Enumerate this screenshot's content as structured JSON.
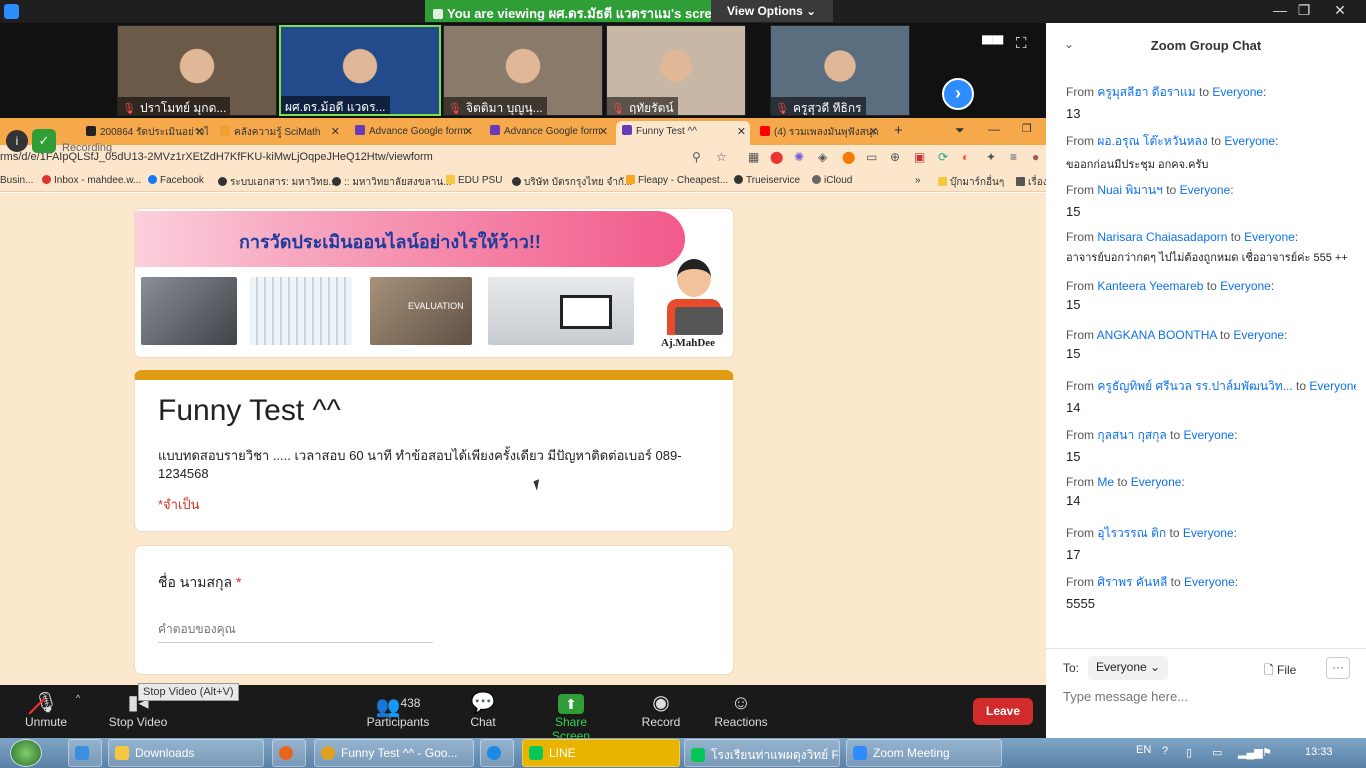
{
  "banner": {
    "viewing_text": "You are viewing ผศ.ดร.มัธตี แวดราแม's screen",
    "view_options": "View Options"
  },
  "participants": [
    {
      "name": "ปราโมทย์ มุกด...",
      "muted": true,
      "active": false,
      "color": "#6b5a48"
    },
    {
      "name": "ผศ.ดร.ม้อดี แวดร...",
      "muted": false,
      "active": true,
      "color": "#234a8a"
    },
    {
      "name": "จิตติมา บุญนุ...",
      "muted": true,
      "active": false,
      "color": "#8a7a6a"
    },
    {
      "name": "ฤทัยรัตน์",
      "muted": true,
      "active": false,
      "color": "#c9b7a5"
    },
    {
      "name": "ครูสุวดี ทีธิกร",
      "muted": true,
      "active": false,
      "color": "#5a6e80"
    }
  ],
  "browser": {
    "tabs": [
      {
        "label": "200864 รัดประเมินอย่างไ",
        "fav": "#222"
      },
      {
        "label": "คลังความรู้ SciMath",
        "fav": "#f0a030"
      },
      {
        "label": "Advance Google form",
        "fav": "#673ab7"
      },
      {
        "label": "Advance Google form",
        "fav": "#673ab7"
      },
      {
        "label": "Funny Test ^^",
        "fav": "#673ab7"
      },
      {
        "label": "(4) รวมเพลงมันพุฟังสนุก",
        "fav": "#ff0000"
      }
    ],
    "url": "rms/d/e/1FAIpQLSfJ_05dU13-2MVz1rXEtZdH7KfFKU-kiMwLjOqpeJHeQ12Htw/viewform",
    "bookmarks": [
      "Busin...",
      "Inbox - mahdee.w...",
      "Facebook",
      "ระบบเอกสาร: มหาวิทย...",
      ":: มหาวิทยาลัยสงขลาน...",
      "EDU PSU",
      "บริษัท บัตรกรุงไทย จำกั...",
      "Fleapy - Cheapest...",
      "Trueiservice",
      "iCloud",
      "»",
      "บุ๊กมาร์กอื่นๆ",
      "เรื่อง"
    ],
    "recording": "Recording"
  },
  "form": {
    "header_title": "การวัดประเมินออนไลน์อย่างไรให้ว้าว!!",
    "header_sign": "Aj.MahDee",
    "evaluation_label": "EVALUATION",
    "title": "Funny Test ^^",
    "description": "แบบทดสอบรายวิชา ..... เวลาสอบ 60 นาที  ทำข้อสอบได้เพียงครั้งเดียว  มีปัญหาติดต่อเบอร์ 089-1234568",
    "required_note": "*จำเป็น",
    "name_question": "ชื่อ นามสกุล",
    "required_star": "*",
    "answer_placeholder": "คำตอบของคุณ"
  },
  "toolbar": {
    "unmute": "Unmute",
    "stop_video": "Stop Video",
    "tooltip": "Stop Video (Alt+V)",
    "participants": "Participants",
    "participant_count": "438",
    "chat": "Chat",
    "share_screen": "Share Screen",
    "record": "Record",
    "reactions": "Reactions",
    "leave": "Leave"
  },
  "chat": {
    "title": "Zoom Group Chat",
    "messages": [
      {
        "from": "ครูมุสลีฮา  ดีอราแม",
        "to": "Everyone",
        "text": "13"
      },
      {
        "from": "ผอ.อรุณ  โต๊ะหวันหลง",
        "to": "Everyone",
        "text": "ขออกก่อนมีประชุม อกคจ.ครับ"
      },
      {
        "from": "Nuai พิมานฯ",
        "to": "Everyone",
        "text": "15"
      },
      {
        "from": "Narisara Chaiasadaporn",
        "to": "Everyone",
        "text": "อาจารย์บอกว่ากดๆ ไปไม่ต้องถูกหมด  เชื่ออาจารย์ค่ะ 555 ++"
      },
      {
        "from": "Kanteera Yeemareb",
        "to": "Everyone",
        "text": "15"
      },
      {
        "from": "ANGKANA BOONTHA",
        "to": "Everyone",
        "text": "15"
      },
      {
        "from": "ครูธัญทิพย์  ศรีนวล รร.ปาล์มพัฒนวิท...",
        "to": "Everyone",
        "text": "14"
      },
      {
        "from": "กุลสนา กุสกุล",
        "to": "Everyone",
        "text": "15"
      },
      {
        "from": "Me",
        "to": "Everyone",
        "text": "14"
      },
      {
        "from": "อุไรวรรณ ติก",
        "to": "Everyone",
        "text": "17"
      },
      {
        "from": "ศิราพร คันหลี",
        "to": "Everyone",
        "text": "5555"
      }
    ],
    "from_label": "From",
    "to_label": "to",
    "to_field_label": "To:",
    "to_value": "Everyone",
    "file_label": "File",
    "input_placeholder": "Type message here..."
  },
  "taskbar": {
    "items": [
      "Downloads",
      "Funny Test ^^ - Goo...",
      "LINE",
      "โรงเรียนท่าแพผดุงวิทย์ FC",
      "Zoom Meeting"
    ],
    "lang": "EN",
    "time": "13:33"
  }
}
